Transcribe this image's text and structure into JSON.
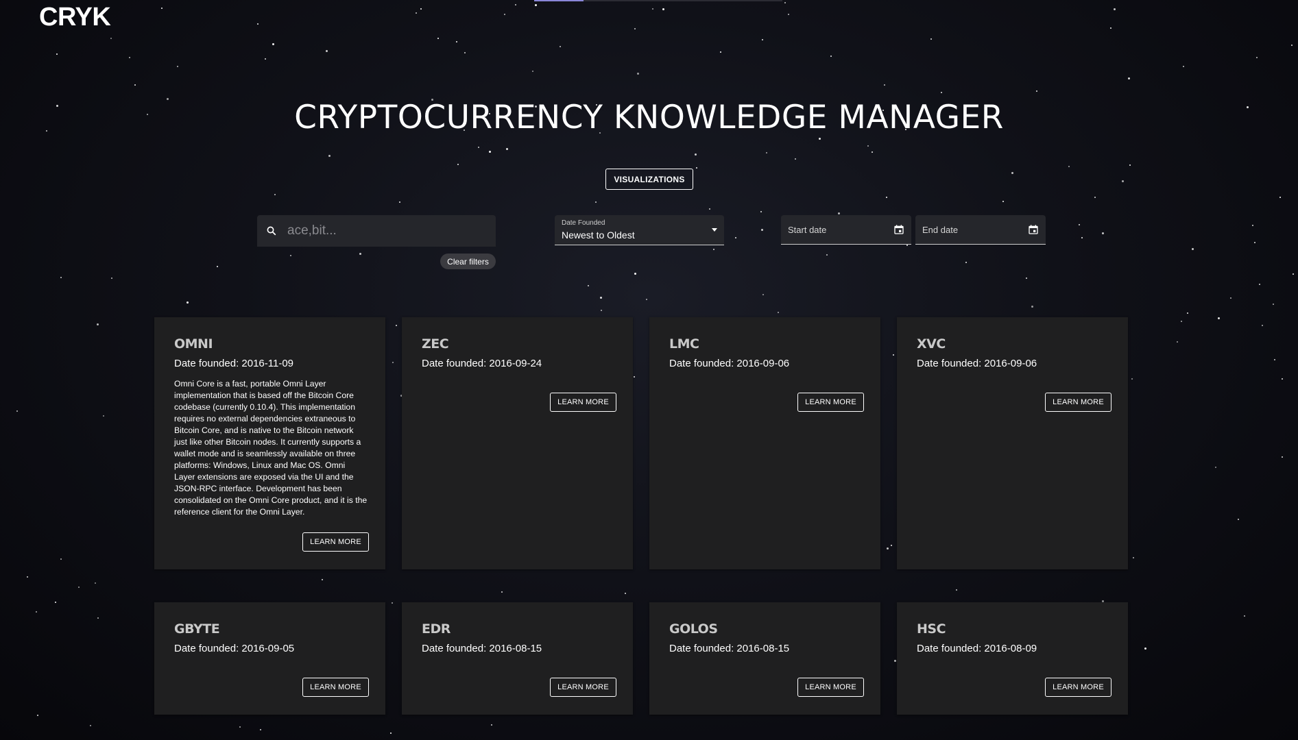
{
  "header": {
    "logo": "CRYK"
  },
  "hero": {
    "title": "CRYPTOCURRENCY KNOWLEDGE MANAGER",
    "visualizations_label": "VISUALIZATIONS"
  },
  "filters": {
    "search_placeholder": "ace,bit...",
    "search_value": "",
    "clear_label": "Clear filters",
    "sort_label": "Date Founded",
    "sort_value": "Newest to Oldest",
    "start_date_placeholder": "Start date",
    "end_date_placeholder": "End date"
  },
  "cards": [
    {
      "symbol": "OMNI",
      "date": "Date founded: 2016-11-09",
      "description": "Omni Core is a fast, portable Omni Layer implementation that is based off the Bitcoin Core codebase (currently 0.10.4). This implementation requires no external dependencies extraneous to Bitcoin Core, and is native to the Bitcoin network just like other Bitcoin nodes. It currently supports a wallet mode and is seamlessly available on three platforms: Windows, Linux and Mac OS. Omni Layer extensions are exposed via the UI and the JSON-RPC interface. Development has been consolidated on the Omni Core product, and it is the reference client for the Omni Layer.",
      "button": "LEARN MORE"
    },
    {
      "symbol": "ZEC",
      "date": "Date founded: 2016-09-24",
      "description": "",
      "button": "LEARN MORE"
    },
    {
      "symbol": "LMC",
      "date": "Date founded: 2016-09-06",
      "description": "",
      "button": "LEARN MORE"
    },
    {
      "symbol": "XVC",
      "date": "Date founded: 2016-09-06",
      "description": "",
      "button": "LEARN MORE"
    },
    {
      "symbol": "GBYTE",
      "date": "Date founded: 2016-09-05",
      "description": "",
      "button": "LEARN MORE"
    },
    {
      "symbol": "EDR",
      "date": "Date founded: 2016-08-15",
      "description": "",
      "button": "LEARN MORE"
    },
    {
      "symbol": "GOLOS",
      "date": "Date founded: 2016-08-15",
      "description": "",
      "button": "LEARN MORE"
    },
    {
      "symbol": "HSC",
      "date": "Date founded: 2016-08-09",
      "description": "",
      "button": "LEARN MORE"
    }
  ]
}
